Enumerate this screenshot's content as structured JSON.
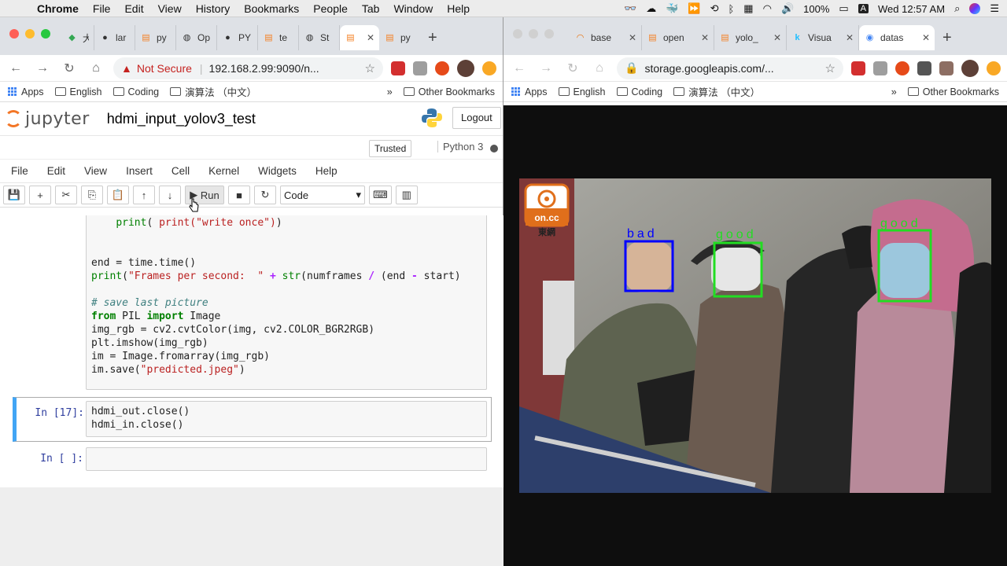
{
  "menubar": {
    "app": "Chrome",
    "items": [
      "File",
      "Edit",
      "View",
      "History",
      "Bookmarks",
      "People",
      "Tab",
      "Window",
      "Help"
    ],
    "battery": "100%",
    "datetime": "Wed 12:57 AM"
  },
  "left_window": {
    "tabs": [
      {
        "label": "大",
        "icon": "maps-icon"
      },
      {
        "label": "lar",
        "icon": "github-icon"
      },
      {
        "label": "py",
        "icon": "stackoverflow-icon"
      },
      {
        "label": "Op",
        "icon": "globe-icon"
      },
      {
        "label": "PY",
        "icon": "github-icon"
      },
      {
        "label": "te",
        "icon": "stackoverflow-icon"
      },
      {
        "label": "St",
        "icon": "globe-icon"
      },
      {
        "label": "",
        "icon": "stackoverflow-icon",
        "active": true
      },
      {
        "label": "py",
        "icon": "stackoverflow-icon"
      }
    ],
    "address": {
      "security": "Not Secure",
      "url": "192.168.2.99:9090/n..."
    },
    "bookmarks": [
      "Apps",
      "English",
      "Coding",
      "演算法 （中文）"
    ],
    "other_bookmarks": "Other Bookmarks",
    "jupyter": {
      "logo_text": "jupyter",
      "notebook_title": "hdmi_input_yolov3_test",
      "logout": "Logout",
      "trusted": "Trusted",
      "kernel": "Python 3",
      "menu": [
        "File",
        "Edit",
        "View",
        "Insert",
        "Cell",
        "Kernel",
        "Widgets",
        "Help"
      ],
      "run_label": "Run",
      "cell_type": "Code",
      "cells": [
        {
          "prompt": "",
          "code_lines": [
            " print(\"write once\")",
            "",
            "",
            "end = time.time()",
            "print(\"Frames per second: \" + str(numframes / (end - start)",
            "",
            "# save last picture",
            "from PIL import Image",
            "img_rgb = cv2.cvtColor(img, cv2.COLOR_BGR2RGB)",
            "plt.imshow(img_rgb)",
            "im = Image.fromarray(img_rgb)",
            "im.save(\"predicted.jpeg\")"
          ]
        },
        {
          "prompt": "In [17]:",
          "code_lines": [
            "hdmi_out.close()",
            "hdmi_in.close()"
          ]
        },
        {
          "prompt": "In [ ]:",
          "code_lines": [
            ""
          ]
        }
      ]
    }
  },
  "right_window": {
    "tabs": [
      {
        "label": "base",
        "icon": "loading-icon"
      },
      {
        "label": "open",
        "icon": "stackoverflow-icon"
      },
      {
        "label": "yolo_",
        "icon": "stackoverflow-icon"
      },
      {
        "label": "Visua",
        "icon": "kaggle-icon"
      },
      {
        "label": "datas",
        "icon": "google-cloud-icon",
        "active": true
      }
    ],
    "address": {
      "url": "storage.googleapis.com/..."
    },
    "bookmarks": [
      "Apps",
      "English",
      "Coding",
      "演算法 （中文）"
    ],
    "other_bookmarks": "Other Bookmarks",
    "image": {
      "watermark_top": "on.cc",
      "watermark_bottom": "東網",
      "detections": [
        {
          "label": "bad",
          "color": "#0000ff"
        },
        {
          "label": "good",
          "color": "#22dd22"
        },
        {
          "label": "good",
          "color": "#22dd22"
        }
      ]
    }
  }
}
